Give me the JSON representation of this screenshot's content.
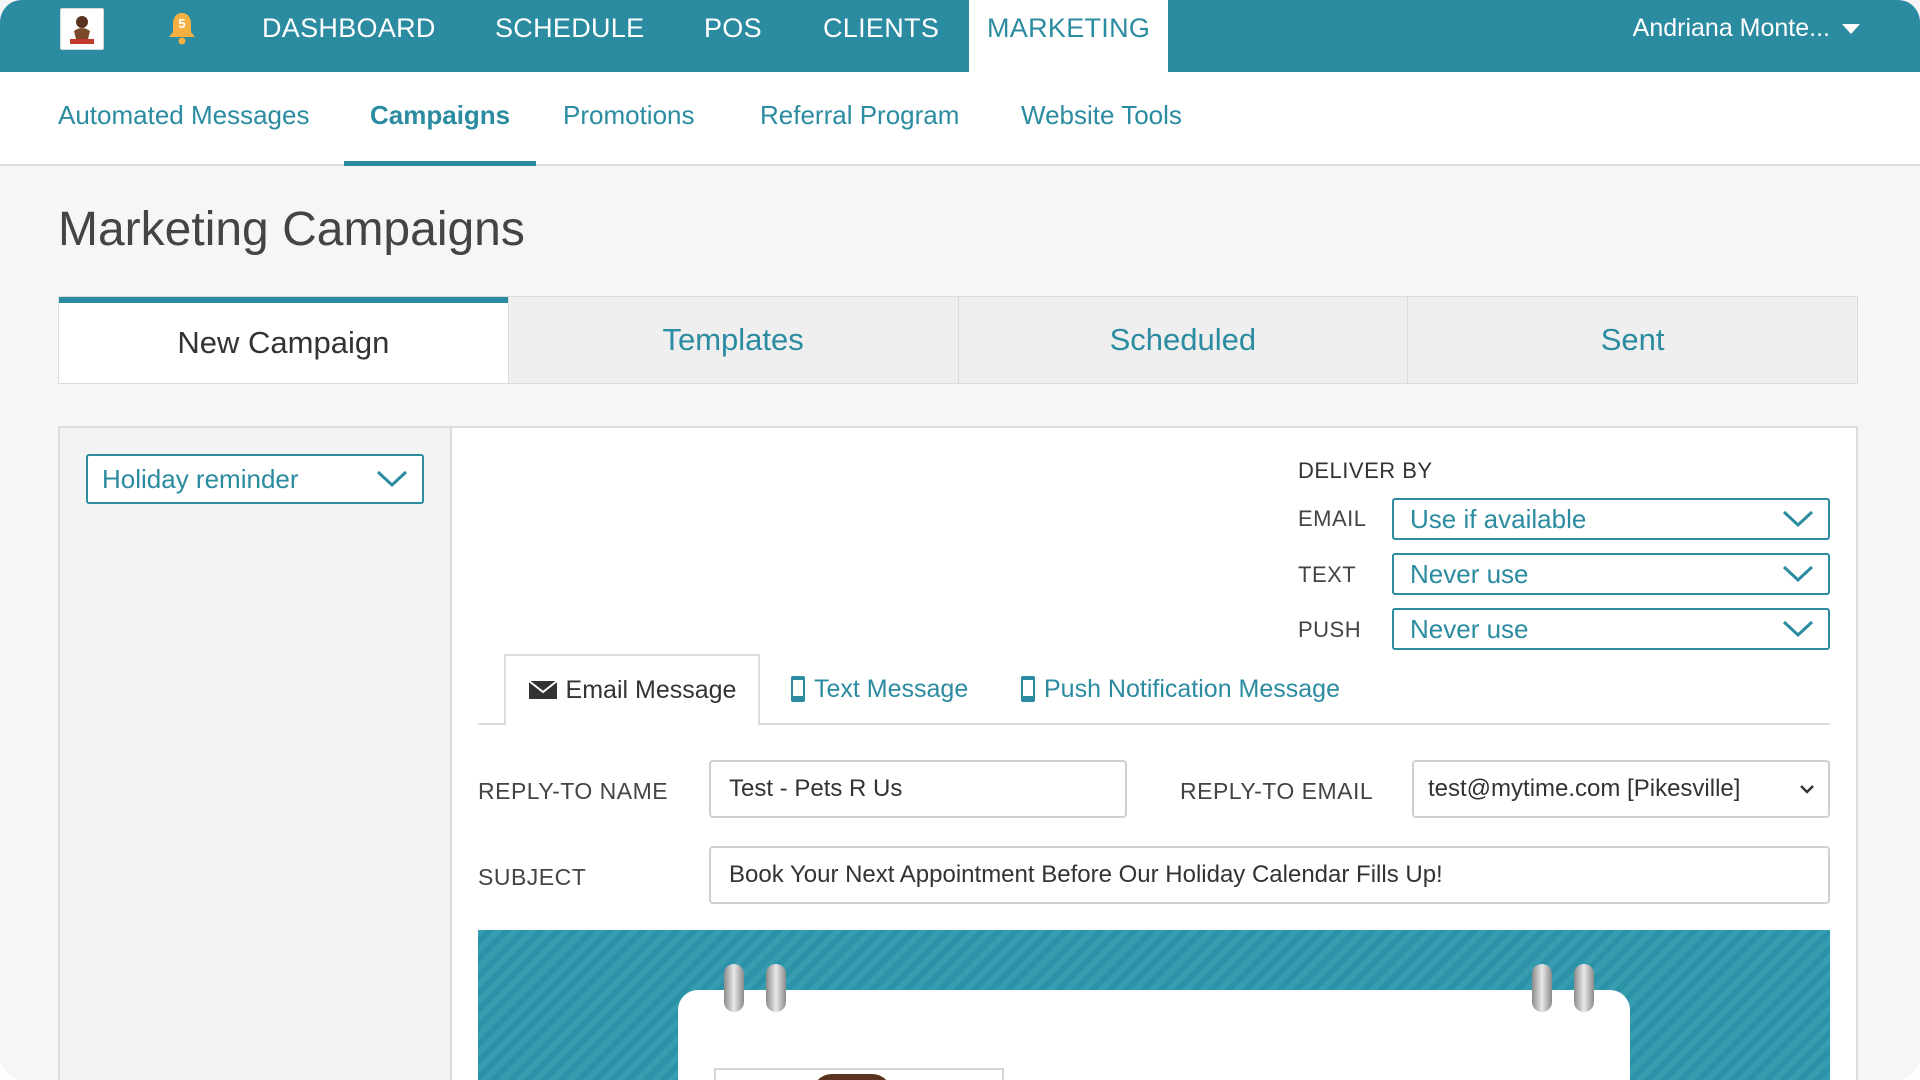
{
  "brand": {
    "accent": "#2b8ba0",
    "logo_icon": "dog-logo-icon",
    "notification_count": "5"
  },
  "topnav": {
    "items": [
      "DASHBOARD",
      "SCHEDULE",
      "POS",
      "CLIENTS",
      "MARKETING"
    ],
    "active": "MARKETING",
    "user": "Andriana Monte..."
  },
  "subnav": {
    "items": [
      "Automated Messages",
      "Campaigns",
      "Promotions",
      "Referral Program",
      "Website Tools"
    ],
    "active": "Campaigns"
  },
  "page": {
    "title": "Marketing Campaigns"
  },
  "tabs": {
    "items": [
      "New Campaign",
      "Templates",
      "Scheduled",
      "Sent"
    ],
    "active": "New Campaign"
  },
  "campaign": {
    "template_select": "Holiday reminder"
  },
  "deliver_by": {
    "heading": "DELIVER BY",
    "email_label": "EMAIL",
    "email_value": "Use if available",
    "text_label": "TEXT",
    "text_value": "Never use",
    "push_label": "PUSH",
    "push_value": "Never use"
  },
  "message_tabs": {
    "email": "Email Message",
    "text": "Text Message",
    "push": "Push Notification Message",
    "active": "Email Message"
  },
  "form": {
    "reply_to_name_label": "REPLY-TO NAME",
    "reply_to_name_value": "Test - Pets R Us",
    "reply_to_email_label": "REPLY-TO EMAIL",
    "reply_to_email_value": "test@mytime.com [Pikesville]",
    "subject_label": "SUBJECT",
    "subject_value": "Book Your Next Appointment Before Our Holiday Calendar Fills Up!"
  }
}
